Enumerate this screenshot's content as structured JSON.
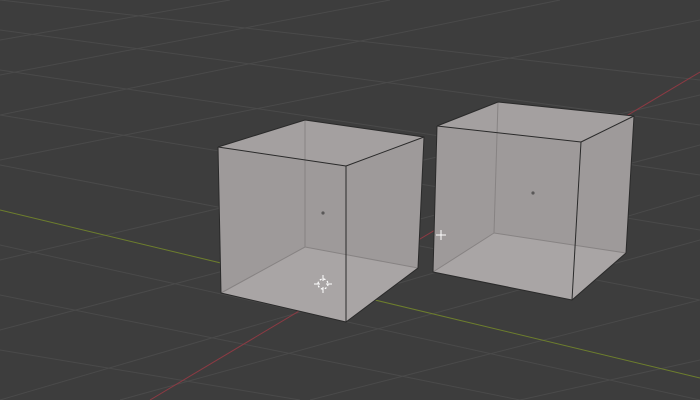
{
  "viewport": {
    "background_color": "#3d3d3d",
    "grid_color": "#4a4a4a",
    "x_axis_color": "#8c3a43",
    "y_axis_color": "#6d7e2d",
    "object_face_color": "#a9a5a5",
    "object_face_alt_color": "#9e9a9a",
    "object_edge_color": "#2a2a2a",
    "hidden_edge_color": "#878383"
  },
  "scene": {
    "objects": [
      {
        "id": "cube-1",
        "type": "mesh",
        "shape": "cube"
      },
      {
        "id": "cube-2",
        "type": "mesh",
        "shape": "cube"
      }
    ],
    "cursor": {
      "name": "3d-cursor-icon"
    }
  }
}
